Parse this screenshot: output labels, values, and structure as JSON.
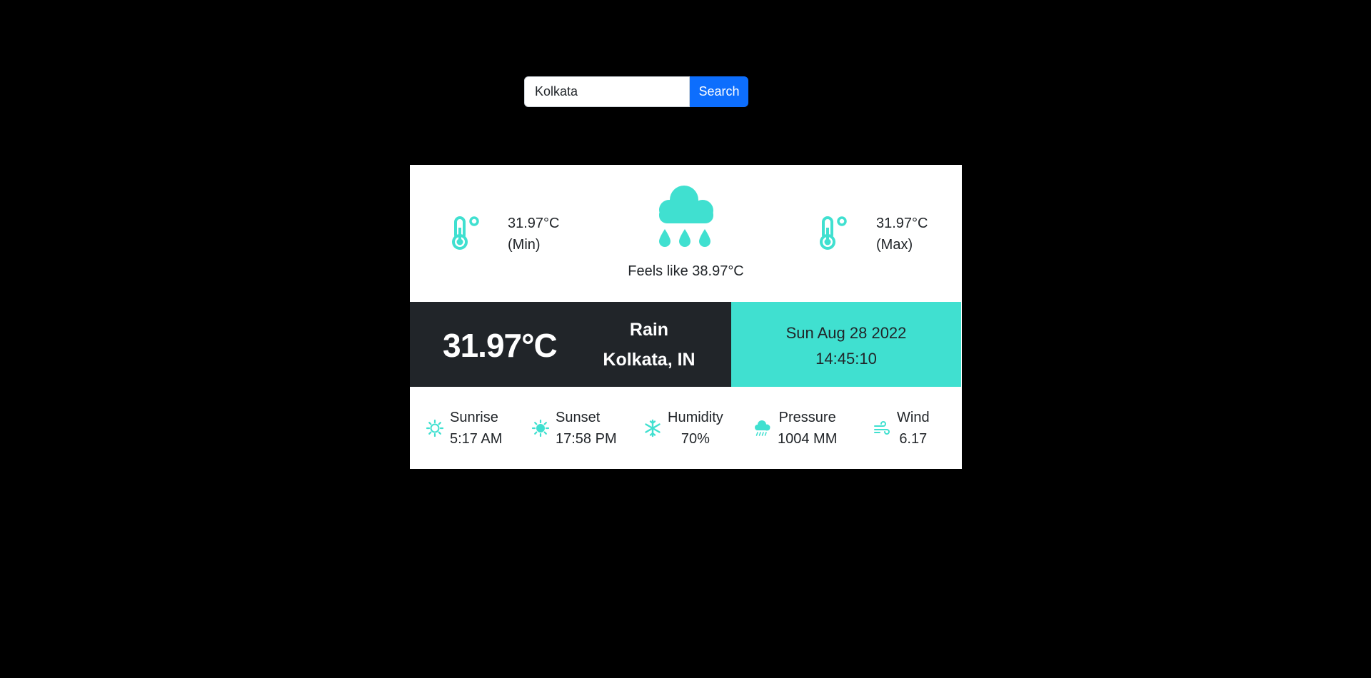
{
  "search": {
    "value": "Kolkata",
    "button_label": "Search"
  },
  "weather": {
    "min_temp": "31.97°C",
    "min_label": "(Min)",
    "max_temp": "31.97°C",
    "max_label": "(Max)",
    "feels_like": "Feels like 38.97°C",
    "current_temp": "31.97°C",
    "condition": "Rain",
    "location": "Kolkata, IN",
    "date": "Sun Aug 28 2022",
    "time": "14:45:10",
    "stats": {
      "sunrise_label": "Sunrise",
      "sunrise_value": "5:17 AM",
      "sunset_label": "Sunset",
      "sunset_value": "17:58 PM",
      "humidity_label": "Humidity",
      "humidity_value": "70%",
      "pressure_label": "Pressure",
      "pressure_value": "1004 MM",
      "wind_label": "Wind",
      "wind_value": "6.17"
    },
    "icons": {
      "main": "cloud-rain-icon",
      "min": "thermometer-icon",
      "max": "thermometer-icon",
      "sunrise": "sun-outline-icon",
      "sunset": "sun-icon",
      "humidity": "snowflake-icon",
      "pressure": "cloud-rain-icon",
      "wind": "wind-icon"
    }
  },
  "colors": {
    "background": "#000000",
    "accent": "#40e0d0",
    "dark": "#212529",
    "button": "#0d6efd"
  }
}
